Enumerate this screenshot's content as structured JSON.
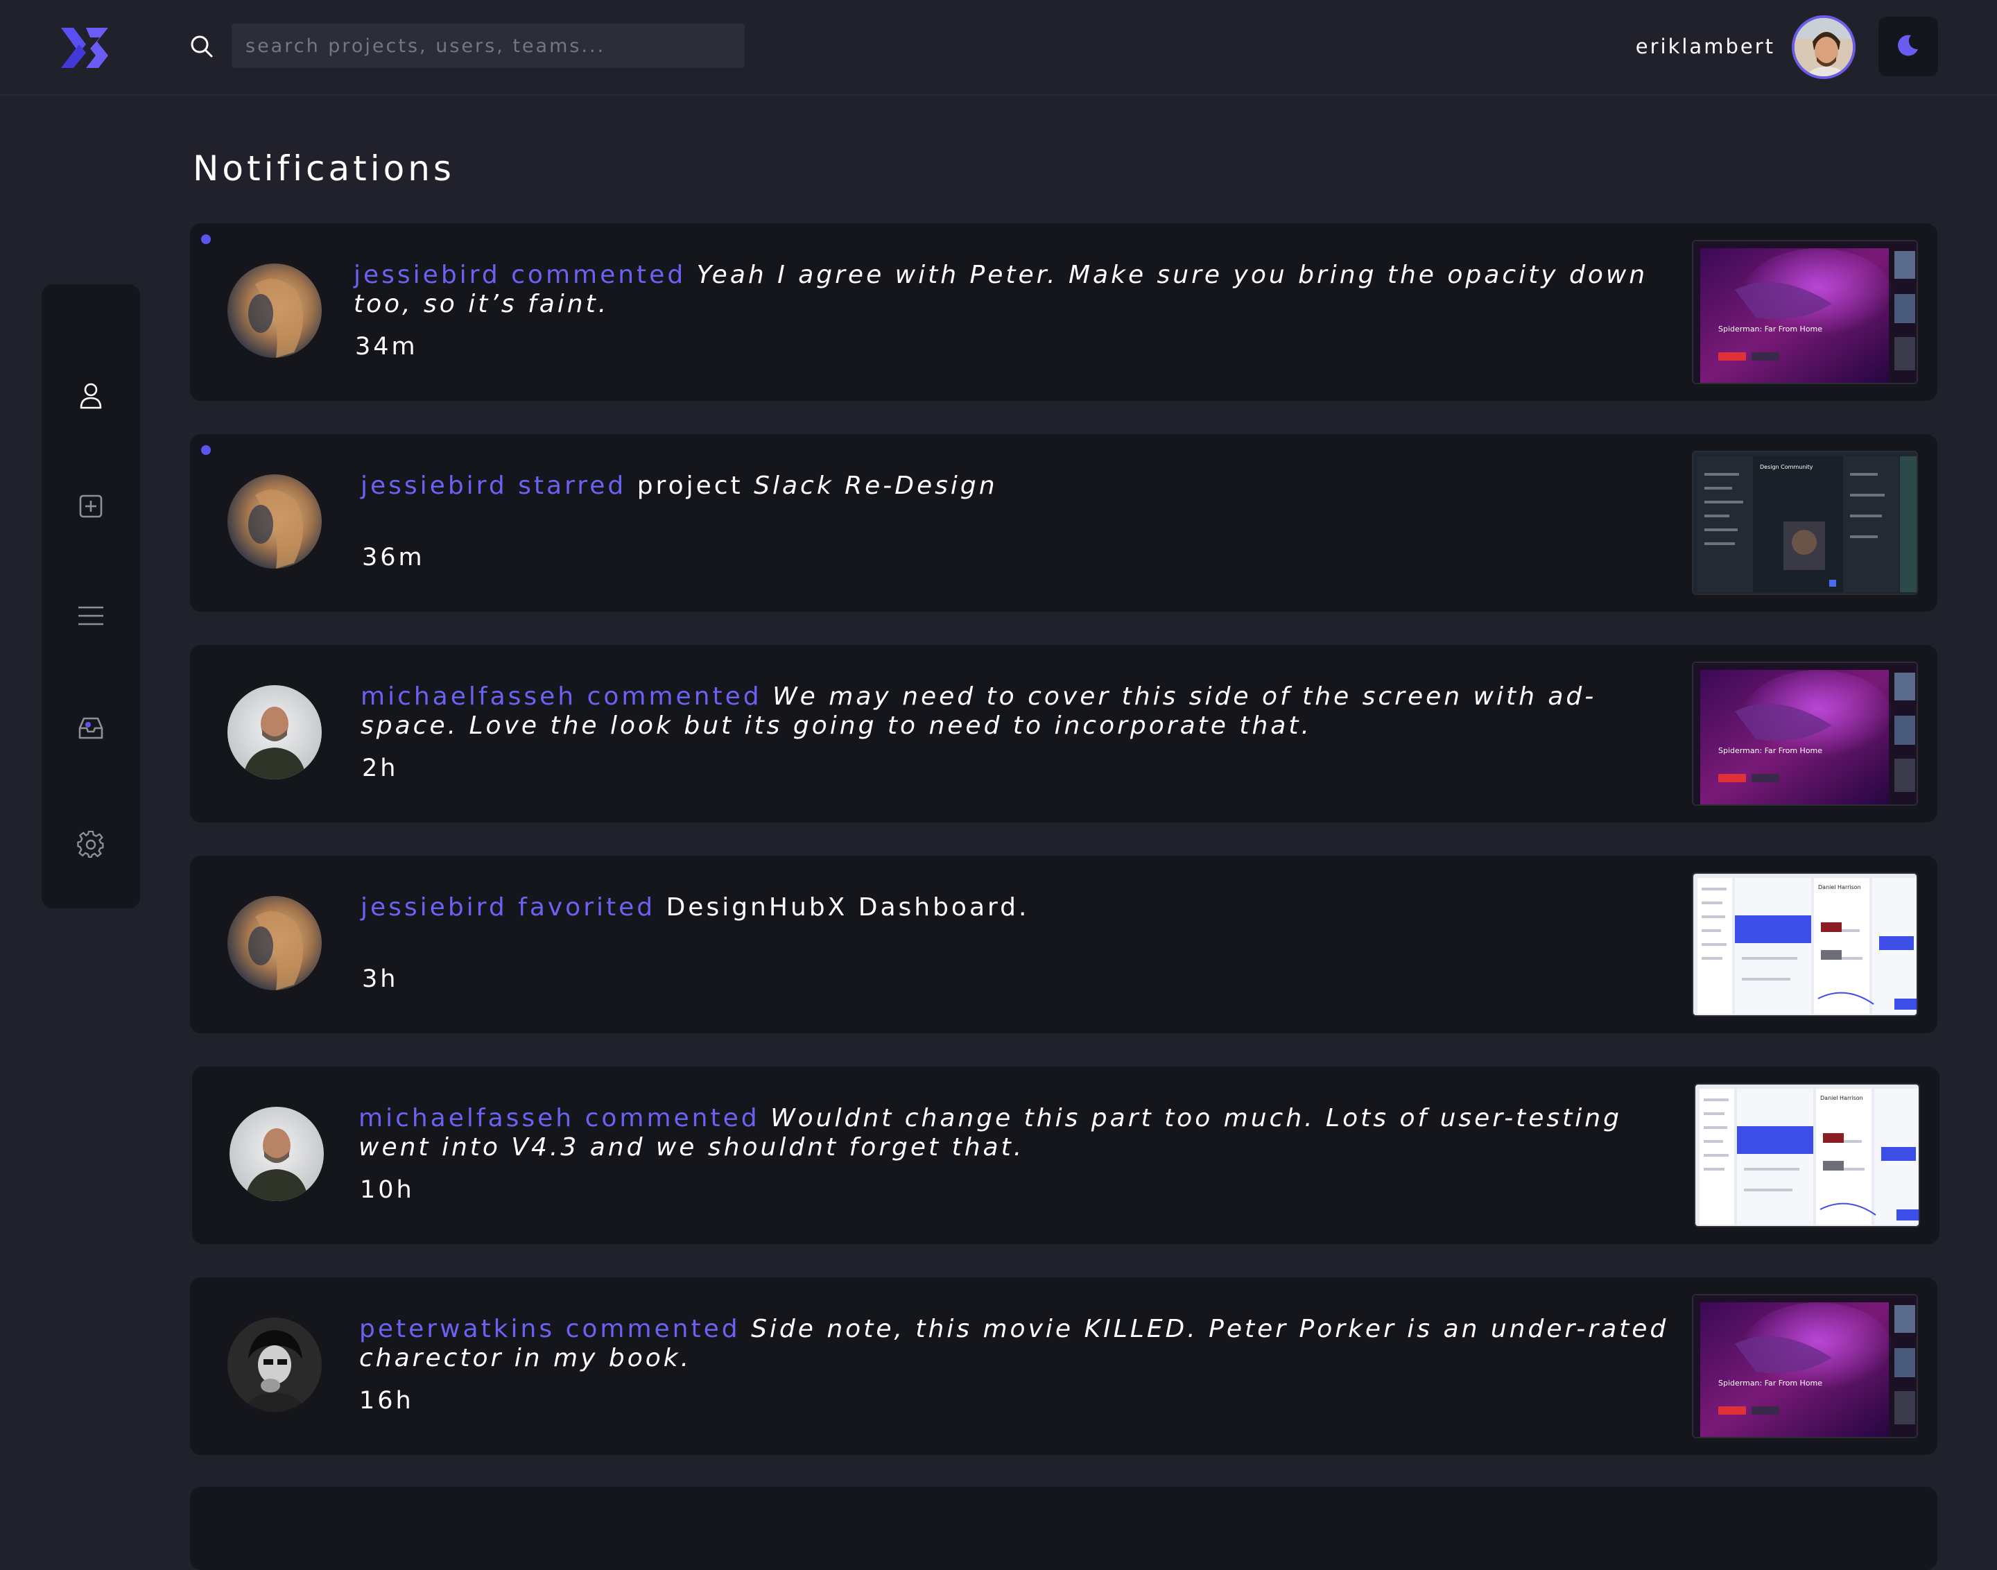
{
  "header": {
    "search_placeholder": "search projects, users, teams...",
    "username": "eriklambert"
  },
  "colors": {
    "background": "#20212a",
    "panel": "#15161b",
    "accent": "#6a62f2"
  },
  "icons": {
    "logo": "x3-logo",
    "search": "search-icon",
    "theme": "moon-icon",
    "sidebar": [
      "user-icon",
      "plus-square-icon",
      "menu-icon",
      "inbox-icon",
      "gear-icon"
    ]
  },
  "page": {
    "title": "Notifications"
  },
  "notifications": [
    {
      "actor": "jessiebird",
      "action": "commented",
      "text": "Yeah I agree with Peter. Make sure you bring the opacity down too, so it’s faint.",
      "time": "34m",
      "unread": true
    },
    {
      "actor": "jessiebird",
      "action": "starred",
      "text_plain": "project",
      "text_italic": "Slack Re-Design",
      "time": "36m",
      "unread": true
    },
    {
      "actor": "michaelfasseh",
      "action": "commented",
      "text": "We may need to cover this side of the screen with ad-space. Love the look but its going to need to incorporate that.",
      "time": "2h"
    },
    {
      "actor": "jessiebird",
      "action": "favorited",
      "text_plain": "DesignHubX Dashboard.",
      "time": "3h"
    },
    {
      "actor": "michaelfasseh",
      "action": "commented",
      "text": "Wouldnt change this part too much. Lots of user-testing went into V4.3 and we shouldnt forget that.",
      "time": "10h"
    },
    {
      "actor": "peterwatkins",
      "action": "commented",
      "text": "Side note, this movie KILLED. Peter Porker is an under-rated charector in my book.",
      "time": "16h"
    }
  ],
  "thumbnail_text": {
    "movie_title": "Spiderman: Far From Home",
    "community_title": "Design Community",
    "dashboard_user": "Daniel Harrison"
  }
}
